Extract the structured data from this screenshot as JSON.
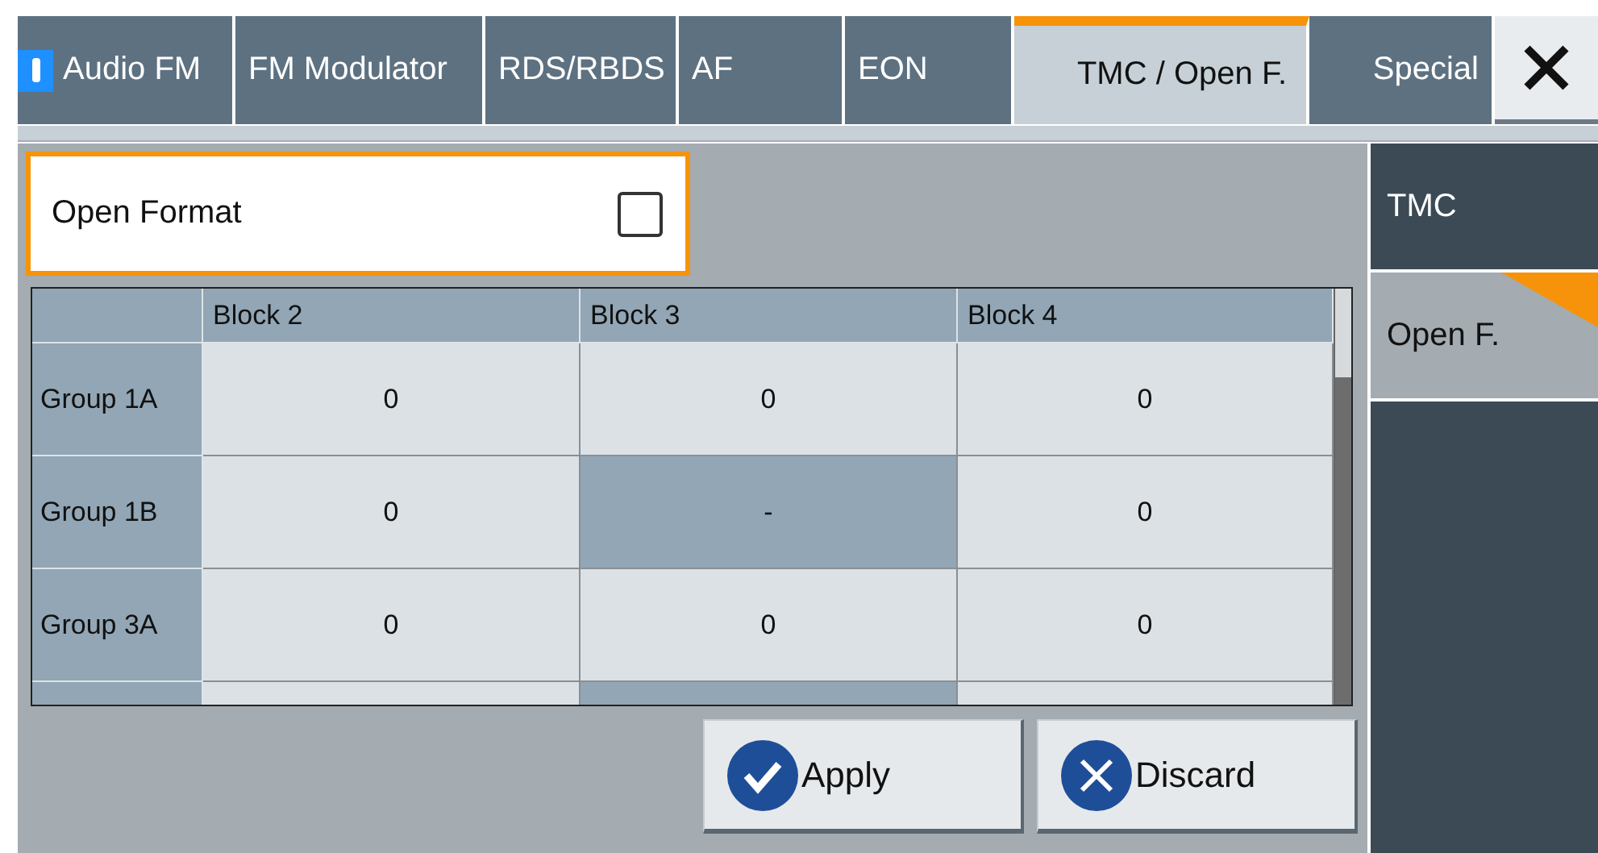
{
  "tabs": [
    {
      "label": "Audio FM",
      "selected": false,
      "on": true
    },
    {
      "label": "FM Modulator",
      "selected": false,
      "on": false
    },
    {
      "label": "RDS/RBDS",
      "selected": false,
      "on": false
    },
    {
      "label": "AF",
      "selected": false,
      "on": false
    },
    {
      "label": "EON",
      "selected": false,
      "on": false
    },
    {
      "label": "TMC / Open F.",
      "selected": true,
      "on": false
    },
    {
      "label": "Special",
      "selected": false,
      "on": false
    }
  ],
  "open_format": {
    "label": "Open Format",
    "checked": false
  },
  "table": {
    "columns": [
      "Block 2",
      "Block 3",
      "Block 4"
    ],
    "rows": [
      {
        "group": "Group 1A",
        "cells": [
          {
            "kind": "value",
            "value": "0"
          },
          {
            "kind": "value",
            "value": "0"
          },
          {
            "kind": "value",
            "value": "0"
          }
        ]
      },
      {
        "group": "Group 1B",
        "cells": [
          {
            "kind": "value",
            "value": "0"
          },
          {
            "kind": "disabled",
            "value": "-"
          },
          {
            "kind": "value",
            "value": "0"
          }
        ]
      },
      {
        "group": "Group 3A",
        "cells": [
          {
            "kind": "value",
            "value": "0"
          },
          {
            "kind": "value",
            "value": "0"
          },
          {
            "kind": "value",
            "value": "0"
          }
        ]
      },
      {
        "cells": [
          {
            "kind": "value"
          },
          {
            "kind": "disabled"
          },
          {
            "kind": "value"
          }
        ]
      }
    ]
  },
  "buttons": [
    {
      "kind": "apply",
      "label": "Apply"
    },
    {
      "kind": "discard",
      "label": "Discard"
    }
  ],
  "side_tabs": [
    {
      "label": "TMC",
      "selected": false
    },
    {
      "label": "Open F.",
      "selected": true
    }
  ]
}
